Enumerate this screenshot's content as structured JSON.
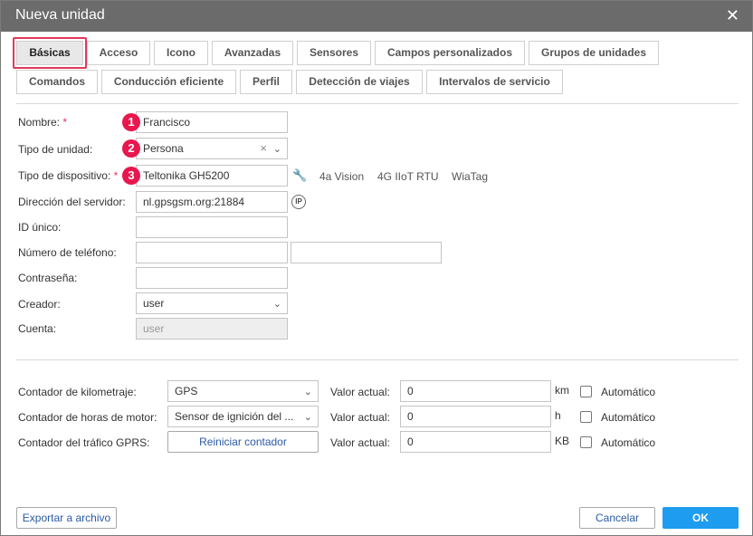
{
  "window": {
    "title": "Nueva unidad",
    "close_glyph": "✕"
  },
  "tabs_row1": [
    {
      "label": "Básicas",
      "active": true
    },
    {
      "label": "Acceso"
    },
    {
      "label": "Icono"
    },
    {
      "label": "Avanzadas"
    },
    {
      "label": "Sensores"
    },
    {
      "label": "Campos personalizados"
    },
    {
      "label": "Grupos de unidades"
    }
  ],
  "tabs_row2": [
    {
      "label": "Comandos"
    },
    {
      "label": "Conducción eficiente"
    },
    {
      "label": "Perfil"
    },
    {
      "label": "Detección de viajes"
    },
    {
      "label": "Intervalos de servicio"
    }
  ],
  "form": {
    "name": {
      "label": "Nombre:",
      "required": "*",
      "value": "Francisco",
      "badge": "1"
    },
    "unit_type": {
      "label": "Tipo de unidad:",
      "value": "Persona",
      "badge": "2"
    },
    "device_type": {
      "label": "Tipo de dispositivo:",
      "required": "*",
      "value": "Teltonika GH5200",
      "badge": "3",
      "suggestions": [
        "4a Vision",
        "4G IIoT RTU",
        "WiaTag"
      ]
    },
    "server_address": {
      "label": "Dirección del servidor:",
      "value": "nl.gpsgsm.org:21884",
      "ip_icon": "IP"
    },
    "unique_id": {
      "label": "ID único:",
      "value": ""
    },
    "phone": {
      "label": "Número de teléfono:",
      "value1": "",
      "value2": ""
    },
    "password": {
      "label": "Contraseña:",
      "value": ""
    },
    "creator": {
      "label": "Creador:",
      "value": "user"
    },
    "account": {
      "label": "Cuenta:",
      "value": "user"
    }
  },
  "counters": {
    "mileage": {
      "label": "Contador de kilometraje:",
      "value": "GPS",
      "current_label": "Valor actual:",
      "current_value": "0",
      "unit": "km",
      "auto_label": "Automático"
    },
    "engine_hours": {
      "label": "Contador de horas de motor:",
      "value": "Sensor de ignición del ...",
      "current_label": "Valor actual:",
      "current_value": "0",
      "unit": "h",
      "auto_label": "Automático"
    },
    "gprs": {
      "label": "Contador del tráfico GPRS:",
      "button": "Reiniciar contador",
      "current_label": "Valor actual:",
      "current_value": "0",
      "unit": "KB",
      "auto_label": "Automático"
    }
  },
  "footer": {
    "export": "Exportar a archivo",
    "cancel": "Cancelar",
    "ok": "OK"
  }
}
